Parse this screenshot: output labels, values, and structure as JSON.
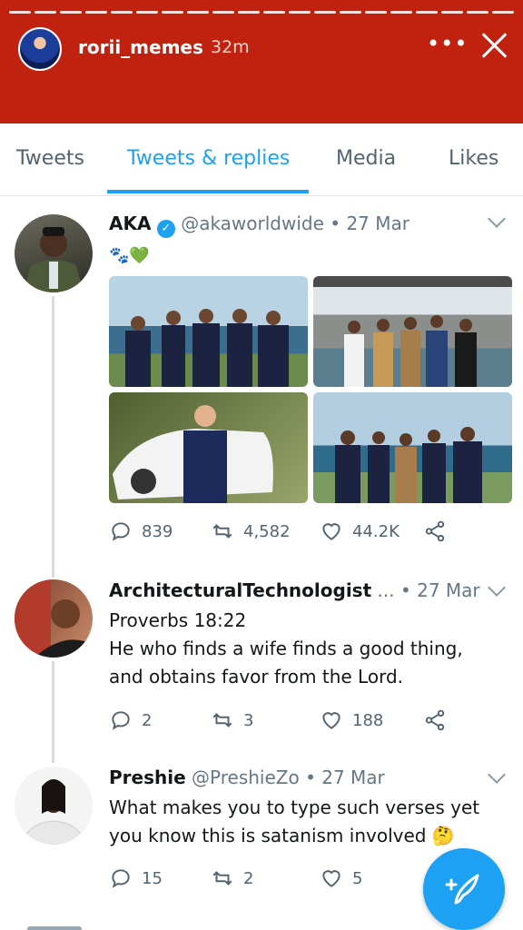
{
  "story": {
    "username": "rorii_memes",
    "time": "32m",
    "more_icon": "more-icon",
    "close_icon": "close-icon"
  },
  "tabs": [
    {
      "label": "Tweets",
      "active": false
    },
    {
      "label": "Tweets & replies",
      "active": true
    },
    {
      "label": "Media",
      "active": false
    },
    {
      "label": "Likes",
      "active": false
    }
  ],
  "tweets": [
    {
      "name": "AKA",
      "verified": true,
      "handle": "@akaworldwide",
      "date": "27 Mar",
      "text": "🐾💚",
      "replies": "839",
      "retweets": "4,582",
      "likes": "44.2K"
    },
    {
      "name": "ArchitecturalTechnologist",
      "name_suffix": "...",
      "date": "27 Mar",
      "text_line1": "Proverbs 18:22",
      "text_line2": "He who finds a wife finds a good thing,",
      "text_line3": "and obtains favor from the Lord.",
      "replies": "2",
      "retweets": "3",
      "likes": "188"
    },
    {
      "name": "Preshie",
      "handle": "@PreshieZo",
      "date": "27 Mar",
      "text_line1": "What makes you to type such verses yet",
      "text_line2": "you know this is satanism involved 🤔",
      "replies": "15",
      "retweets": "2",
      "likes": "5"
    }
  ],
  "colors": {
    "story_bar": "#c0220f",
    "accent": "#1da1f2",
    "verified": "#1da1f2"
  },
  "fab_icon": "compose-tweet-icon"
}
